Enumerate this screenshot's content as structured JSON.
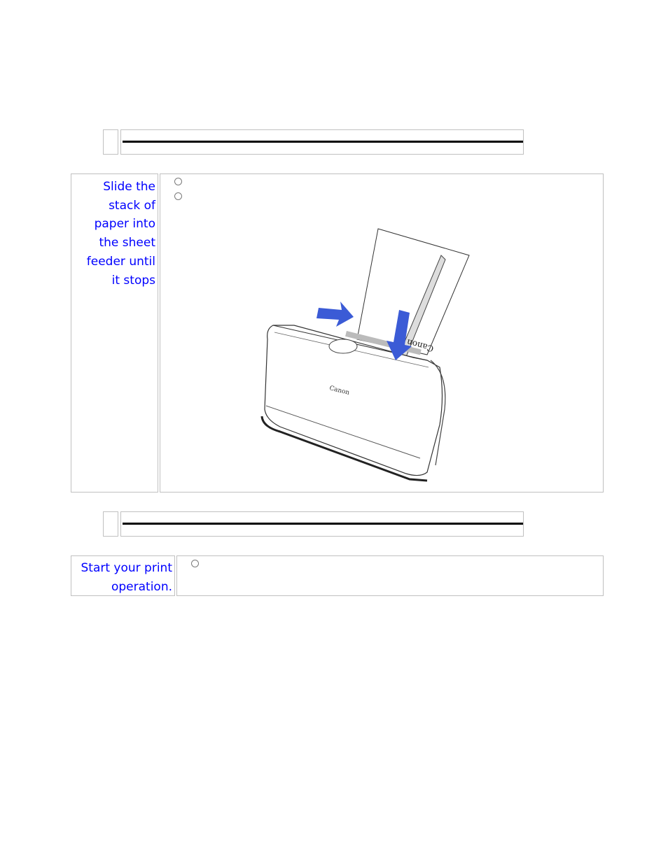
{
  "document": {
    "sections": [
      {
        "id": "section-1",
        "header_rule": true
      },
      {
        "id": "section-2",
        "header_rule": true
      }
    ],
    "steps": [
      {
        "label": "Slide the\nstack of\npaper into\nthe sheet\nfeeder until\nit stops",
        "bullets": [
          "",
          ""
        ],
        "illustration": {
          "subject": "Canon printer with paper stack being inserted into sheet feeder",
          "printer_brand_text": "Canon",
          "paper_brand_text": "Canon",
          "arrows": [
            "right-arrow",
            "down-arrow"
          ]
        }
      },
      {
        "label": "Start your print\noperation.",
        "bullets": [
          ""
        ]
      }
    ]
  },
  "colors": {
    "label_text": "#0000ff",
    "border": "#c0c0c0",
    "rule": "#000000",
    "arrow": "#3b5bd6"
  }
}
